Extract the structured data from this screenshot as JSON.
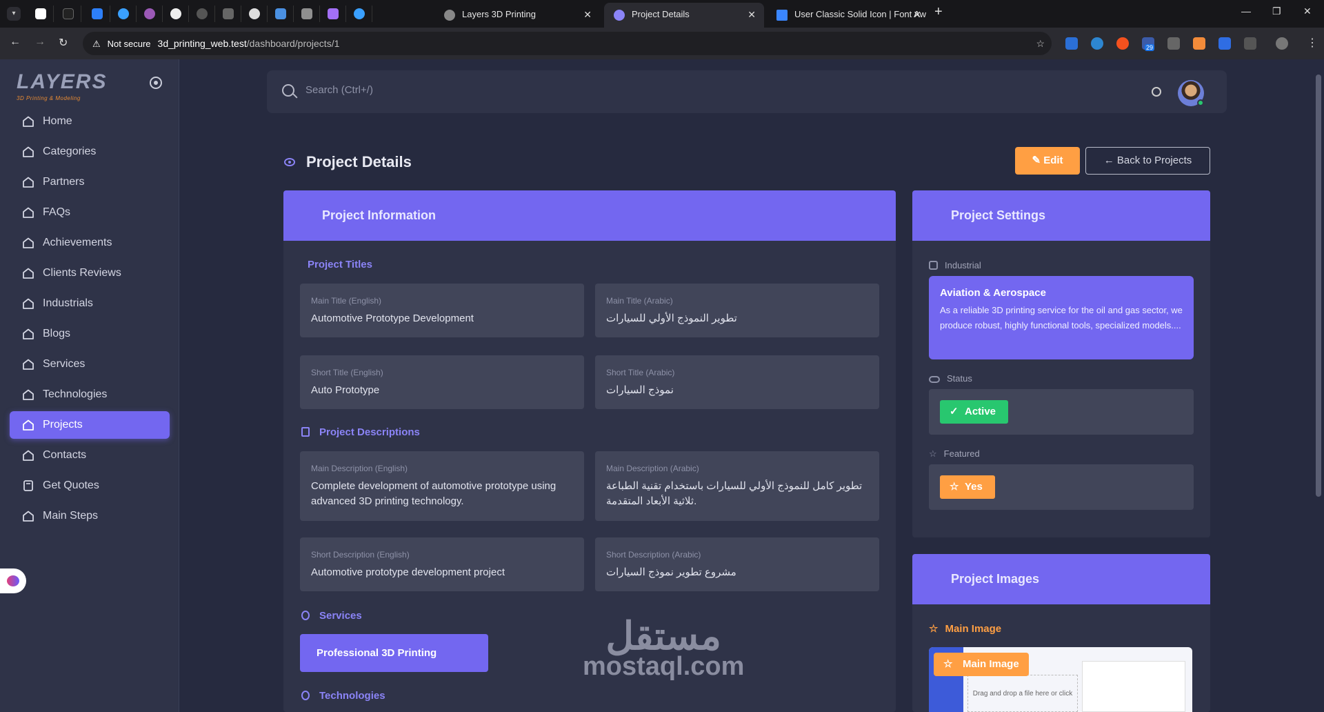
{
  "browser": {
    "tabs": [
      {
        "title": "Layers 3D Printing"
      },
      {
        "title": "Project Details"
      },
      {
        "title": "User Classic Solid Icon | Font Aw"
      }
    ],
    "not_secure": "Not secure",
    "url_host": "3d_printing_web.test",
    "url_path": "/dashboard/projects/1",
    "ext_badge": "29"
  },
  "sidebar": {
    "logo": "LAYERS",
    "logo_sub": "3D Printing & Modeling",
    "items": [
      {
        "label": "Home"
      },
      {
        "label": "Categories"
      },
      {
        "label": "Partners"
      },
      {
        "label": "FAQs"
      },
      {
        "label": "Achievements"
      },
      {
        "label": "Clients Reviews"
      },
      {
        "label": "Industrials"
      },
      {
        "label": "Blogs"
      },
      {
        "label": "Services"
      },
      {
        "label": "Technologies"
      },
      {
        "label": "Projects"
      },
      {
        "label": "Contacts"
      },
      {
        "label": "Get Quotes"
      },
      {
        "label": "Main Steps"
      }
    ]
  },
  "search": {
    "placeholder": "Search (Ctrl+/)"
  },
  "page": {
    "title": "Project Details",
    "edit_label": "Edit",
    "back_label": "Back to Projects"
  },
  "info": {
    "header": "Project Information",
    "titles_section": "Project Titles",
    "main_title_en_label": "Main Title (English)",
    "main_title_en": "Automotive Prototype Development",
    "main_title_ar_label": "Main Title (Arabic)",
    "main_title_ar": "تطوير النموذج الأولي للسيارات",
    "short_title_en_label": "Short Title (English)",
    "short_title_en": "Auto Prototype",
    "short_title_ar_label": "Short Title (Arabic)",
    "short_title_ar": "نموذج السيارات",
    "desc_section": "Project Descriptions",
    "main_desc_en_label": "Main Description (English)",
    "main_desc_en": "Complete development of automotive prototype using advanced 3D printing technology.",
    "main_desc_ar_label": "Main Description (Arabic)",
    "main_desc_ar": "تطوير كامل للنموذج الأولي للسيارات باستخدام تقنية الطباعة ثلاثية الأبعاد المتقدمة.",
    "short_desc_en_label": "Short Description (English)",
    "short_desc_en": "Automotive prototype development project",
    "short_desc_ar_label": "Short Description (Arabic)",
    "short_desc_ar": "مشروع تطوير نموذج السيارات",
    "services_section": "Services",
    "service_item": "Professional 3D Printing",
    "tech_section": "Technologies"
  },
  "settings": {
    "header": "Project Settings",
    "industrial_label": "Industrial",
    "industrial_title": "Aviation & Aerospace",
    "industrial_desc": "As a reliable 3D printing service for the oil and gas sector, we produce robust, highly functional tools, specialized models....",
    "status_label": "Status",
    "status_value": "Active",
    "featured_label": "Featured",
    "featured_value": "Yes"
  },
  "images": {
    "header": "Project Images",
    "main_image_label": "Main Image",
    "main_image_tag": "Main Image",
    "drop_text": "Drag and drop a file here or click"
  },
  "watermark": {
    "line1": "مستقل",
    "line2": "mostaql.com"
  },
  "colors": {
    "accent": "#7367f0",
    "warning": "#ff9f43",
    "success": "#28c76f"
  }
}
